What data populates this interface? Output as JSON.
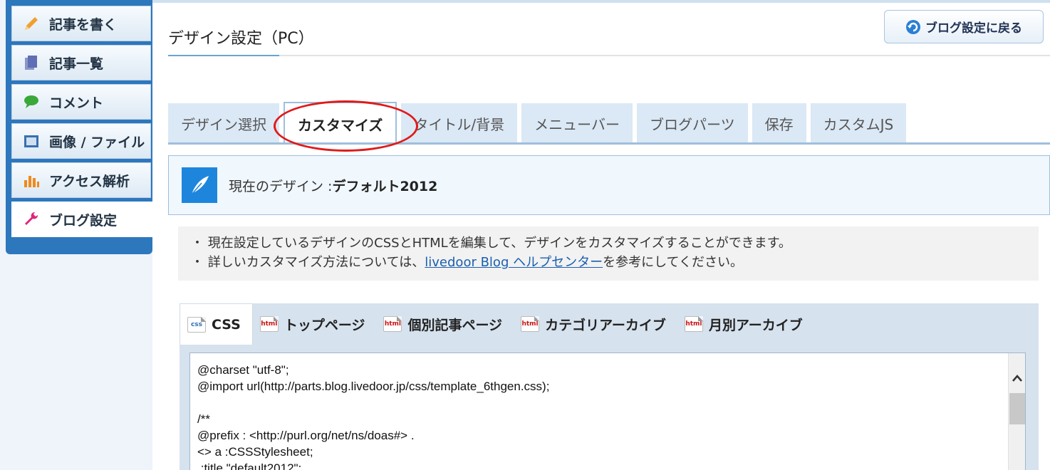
{
  "sidebar": {
    "items": [
      {
        "label": "記事を書く",
        "icon": "pencil-icon",
        "color": "#f0a030"
      },
      {
        "label": "記事一覧",
        "icon": "documents-icon",
        "color": "#5f6fb5"
      },
      {
        "label": "コメント",
        "icon": "speech-bubble-icon",
        "color": "#3aa83a"
      },
      {
        "label": "画像 / ファイル",
        "icon": "image-file-icon",
        "color": "#3a6fae"
      },
      {
        "label": "アクセス解析",
        "icon": "bar-chart-icon",
        "color": "#f08a1c"
      },
      {
        "label": "ブログ設定",
        "icon": "wrench-icon",
        "color": "#e0247a",
        "active": true
      }
    ]
  },
  "header": {
    "title": "デザイン設定（PC）",
    "back_button": "ブログ設定に戻る"
  },
  "tabs": [
    {
      "label": "デザイン選択"
    },
    {
      "label": "カスタマイズ",
      "active": true
    },
    {
      "label": "タイトル/背景"
    },
    {
      "label": "メニューバー"
    },
    {
      "label": "ブログパーツ"
    },
    {
      "label": "保存"
    },
    {
      "label": "カスタムJS"
    }
  ],
  "current_design": {
    "label": "現在のデザイン : ",
    "name": "デフォルト2012"
  },
  "info": {
    "line1": "・ 現在設定しているデザインのCSSとHTMLを編集して、デザインをカスタマイズすることができます。",
    "line2_prefix": "・ 詳しいカスタマイズ方法については、",
    "line2_link": "livedoor Blog ヘルプセンター",
    "line2_suffix": "を参考にしてください。"
  },
  "file_tabs": [
    {
      "label": "CSS",
      "badge": "css",
      "active": true
    },
    {
      "label": "トップページ",
      "badge": "html"
    },
    {
      "label": "個別記事ページ",
      "badge": "html"
    },
    {
      "label": "カテゴリアーカイブ",
      "badge": "html"
    },
    {
      "label": "月別アーカイブ",
      "badge": "html"
    }
  ],
  "editor": {
    "code": "@charset \"utf-8\";\n@import url(http://parts.blog.livedoor.jp/css/template_6thgen.css);\n\n/**\n@prefix : <http://purl.org/net/ns/doas#> .\n<> a :CSSStylesheet;\n :title \"default2012\";"
  }
}
